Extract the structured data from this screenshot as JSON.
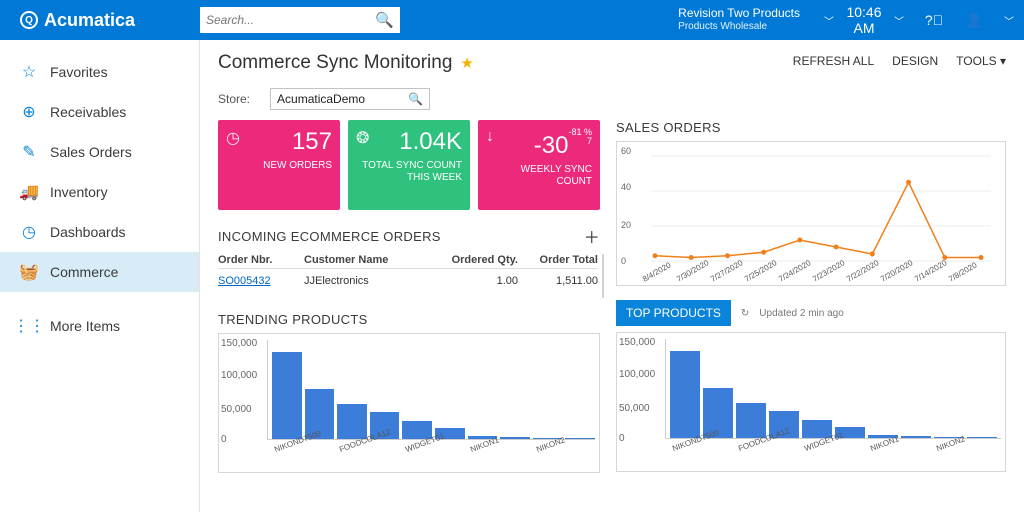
{
  "brand": "Acumatica",
  "search": {
    "placeholder": "Search..."
  },
  "tenant": {
    "name": "Revision Two Products",
    "sub": "Products Wholesale"
  },
  "clock": "10:46 AM",
  "sidebar": {
    "items": [
      {
        "label": "Favorites",
        "icon": "☆"
      },
      {
        "label": "Receivables",
        "icon": "⊕"
      },
      {
        "label": "Sales Orders",
        "icon": "✎"
      },
      {
        "label": "Inventory",
        "icon": "🚚"
      },
      {
        "label": "Dashboards",
        "icon": "◷"
      },
      {
        "label": "Commerce",
        "icon": "🧺"
      },
      {
        "label": "More Items",
        "icon": "⋮⋮"
      }
    ]
  },
  "page": {
    "title": "Commerce Sync Monitoring"
  },
  "actions": {
    "refresh": "REFRESH ALL",
    "design": "DESIGN",
    "tools": "TOOLS"
  },
  "store": {
    "label": "Store:",
    "value": "AcumaticaDemo"
  },
  "cards": {
    "new_orders": {
      "value": "157",
      "label": "NEW ORDERS"
    },
    "total_sync": {
      "value": "1.04K",
      "label": "TOTAL SYNC COUNT THIS WEEK"
    },
    "weekly_sync": {
      "value": "-30",
      "delta_pct": "-81 %",
      "delta_n": "7",
      "label": "WEEKLY SYNC COUNT"
    }
  },
  "incoming": {
    "title": "INCOMING ECOMMERCE ORDERS",
    "cols": {
      "nbr": "Order Nbr.",
      "cust": "Customer Name",
      "qty": "Ordered Qty.",
      "total": "Order Total"
    },
    "row": {
      "nbr": "SO005432",
      "cust": "JJElectronics",
      "qty": "1.00",
      "total": "1,511.00"
    }
  },
  "trending": {
    "title": "TRENDING PRODUCTS"
  },
  "sales_orders": {
    "title": "SALES ORDERS"
  },
  "top_products": {
    "title": "TOP PRODUCTS",
    "updated": "Updated 2 min ago"
  },
  "chart_data": [
    {
      "type": "line",
      "name": "sales_orders",
      "title": "SALES ORDERS",
      "ylim": [
        0,
        60
      ],
      "yticks": [
        0,
        20,
        40,
        60
      ],
      "categories": [
        "8/4/2020",
        "7/30/2020",
        "7/27/2020",
        "7/25/2020",
        "7/24/2020",
        "7/23/2020",
        "7/22/2020",
        "7/20/2020",
        "7/14/2020",
        "7/8/2020"
      ],
      "values": [
        3,
        2,
        3,
        5,
        12,
        8,
        4,
        45,
        2,
        2
      ]
    },
    {
      "type": "bar",
      "name": "trending_products",
      "title": "TRENDING PRODUCTS",
      "ylim": [
        0,
        150000
      ],
      "yticks": [
        0,
        50000,
        100000,
        150000
      ],
      "categories": [
        "NIKOND7500",
        "FOODCOLA12",
        "WIDGET01",
        "NIKON1",
        "NIKON2"
      ],
      "values": [
        130000,
        75000,
        52000,
        41000,
        27000,
        16000,
        4000,
        3000,
        2000,
        2000
      ]
    },
    {
      "type": "bar",
      "name": "top_products",
      "title": "TOP PRODUCTS",
      "ylim": [
        0,
        150000
      ],
      "yticks": [
        0,
        50000,
        100000,
        150000
      ],
      "categories": [
        "NIKOND7500",
        "FOODCOLA12",
        "WIDGET01",
        "NIKON1",
        "NIKON2"
      ],
      "values": [
        130000,
        75000,
        52000,
        41000,
        27000,
        16000,
        4000,
        3000,
        2000,
        2000
      ]
    }
  ]
}
